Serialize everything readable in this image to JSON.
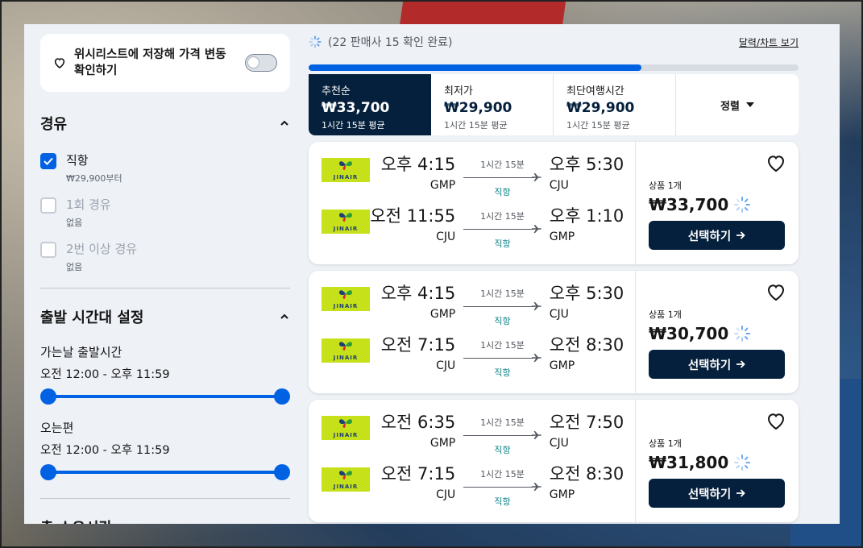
{
  "sidebar": {
    "wishlist_text": "위시리스트에 저장해 가격 변동 확인하기",
    "stops": {
      "title": "경유",
      "options": [
        {
          "label": "직항",
          "sub": "₩29,900부터",
          "checked": true
        },
        {
          "label": "1회 경유",
          "sub": "없음",
          "checked": false
        },
        {
          "label": "2번 이상 경유",
          "sub": "없음",
          "checked": false
        }
      ]
    },
    "departure_times": {
      "title": "출발 시간대 설정",
      "outbound_label": "가는날 출발시간",
      "outbound_range": "오전 12:00 - 오후 11:59",
      "return_label": "오는편",
      "return_range": "오전 12:00 - 오후 11:59"
    },
    "duration": {
      "title": "총 소요시간"
    }
  },
  "main": {
    "loading_text": "(22 판매사 15 확인 완료)",
    "calendar_link": "달력/차트 보기",
    "progress_percent": 68,
    "sort_tabs": [
      {
        "title": "추천순",
        "price": "₩33,700",
        "sub": "1시간 15분 평균",
        "active": true
      },
      {
        "title": "최저가",
        "price": "₩29,900",
        "sub": "1시간 15분 평균",
        "active": false
      },
      {
        "title": "최단여행시간",
        "price": "₩29,900",
        "sub": "1시간 15분 평균",
        "active": false
      }
    ],
    "sort_by_label": "정렬",
    "results": [
      {
        "legs": [
          {
            "dep_time": "오후 4:15",
            "dep_code": "GMP",
            "duration": "1시간 15분",
            "stops": "직항",
            "arr_time": "오후 5:30",
            "arr_code": "CJU"
          },
          {
            "dep_time": "오전 11:55",
            "dep_code": "CJU",
            "duration": "1시간 15분",
            "stops": "직항",
            "arr_time": "오후 1:10",
            "arr_code": "GMP"
          }
        ],
        "deals": "상품 1개",
        "price": "₩33,700",
        "button": "선택하기"
      },
      {
        "legs": [
          {
            "dep_time": "오후 4:15",
            "dep_code": "GMP",
            "duration": "1시간 15분",
            "stops": "직항",
            "arr_time": "오후 5:30",
            "arr_code": "CJU"
          },
          {
            "dep_time": "오전 7:15",
            "dep_code": "CJU",
            "duration": "1시간 15분",
            "stops": "직항",
            "arr_time": "오전 8:30",
            "arr_code": "GMP"
          }
        ],
        "deals": "상품 1개",
        "price": "₩30,700",
        "button": "선택하기"
      },
      {
        "legs": [
          {
            "dep_time": "오전 6:35",
            "dep_code": "GMP",
            "duration": "1시간 15분",
            "stops": "직항",
            "arr_time": "오전 7:50",
            "arr_code": "CJU"
          },
          {
            "dep_time": "오전 7:15",
            "dep_code": "CJU",
            "duration": "1시간 15분",
            "stops": "직항",
            "arr_time": "오전 8:30",
            "arr_code": "GMP"
          }
        ],
        "deals": "상품 1개",
        "price": "₩31,800",
        "button": "선택하기"
      }
    ],
    "airline_logo_text": "JINAIR"
  },
  "colors": {
    "accent": "#0062e3",
    "navy": "#05203c",
    "airline_logo_bg": "#c6e01a",
    "stops_teal": "#0c838a"
  }
}
